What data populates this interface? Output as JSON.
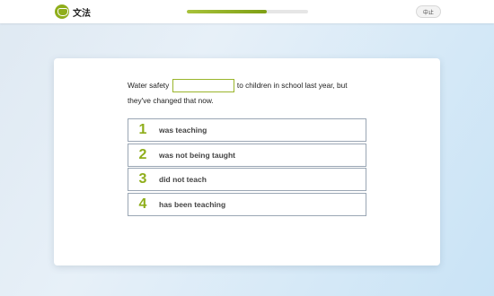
{
  "header": {
    "app_title": "文法",
    "logo_icon": "owl-logo-icon",
    "progress_fraction": 0.66,
    "abort_label": "中止"
  },
  "question": {
    "text_before": "Water safety",
    "text_after": "to children in school last year, but they've changed that now."
  },
  "options": [
    {
      "number": "1",
      "label": "was teaching"
    },
    {
      "number": "2",
      "label": "was not being taught"
    },
    {
      "number": "3",
      "label": "did not teach"
    },
    {
      "number": "4",
      "label": "has been teaching"
    }
  ],
  "colors": {
    "accent": "#8fae1b",
    "option_border": "#9aa6b4"
  }
}
